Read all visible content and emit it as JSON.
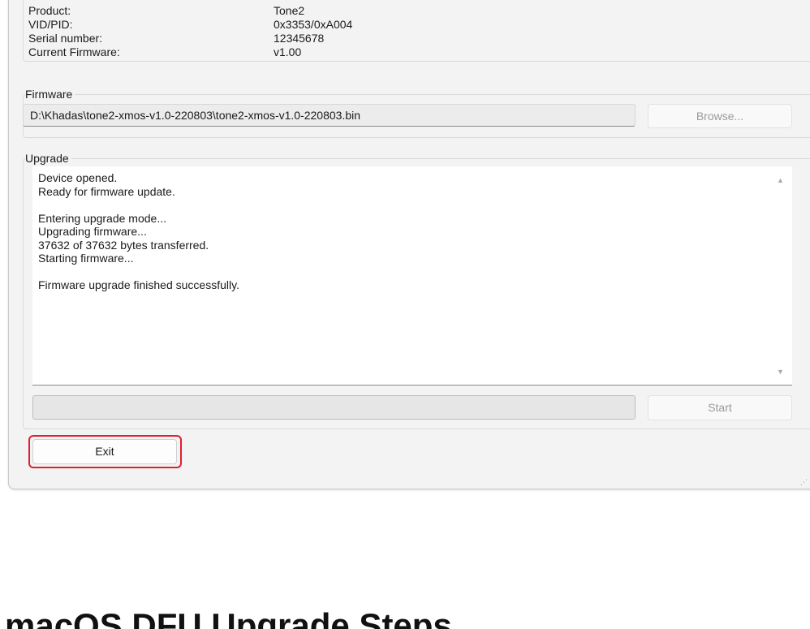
{
  "device_info": {
    "rows": [
      {
        "label": "Product:",
        "value": "Tone2"
      },
      {
        "label": "VID/PID:",
        "value": "0x3353/0xA004"
      },
      {
        "label": "Serial number:",
        "value": "12345678"
      },
      {
        "label": "Current Firmware:",
        "value": "v1.00"
      }
    ]
  },
  "firmware": {
    "group_label": "Firmware",
    "path": "D:\\Khadas\\tone2-xmos-v1.0-220803\\tone2-xmos-v1.0-220803.bin",
    "browse_label": "Browse..."
  },
  "upgrade": {
    "group_label": "Upgrade",
    "log": "Device opened.\nReady for firmware update.\n\nEntering upgrade mode...\nUpgrading firmware...\n37632 of 37632 bytes transferred.\nStarting firmware...\n\nFirmware upgrade finished successfully.",
    "progress_fraction": 0.0,
    "start_label": "Start",
    "scroll_up_icon": "triangle-up-icon",
    "scroll_down_icon": "triangle-down-icon"
  },
  "exit_label": "Exit",
  "colors": {
    "highlight": "#e0202e",
    "progress_fill": "#06b025"
  },
  "page_heading": "macOS DFU Upgrade Steps"
}
